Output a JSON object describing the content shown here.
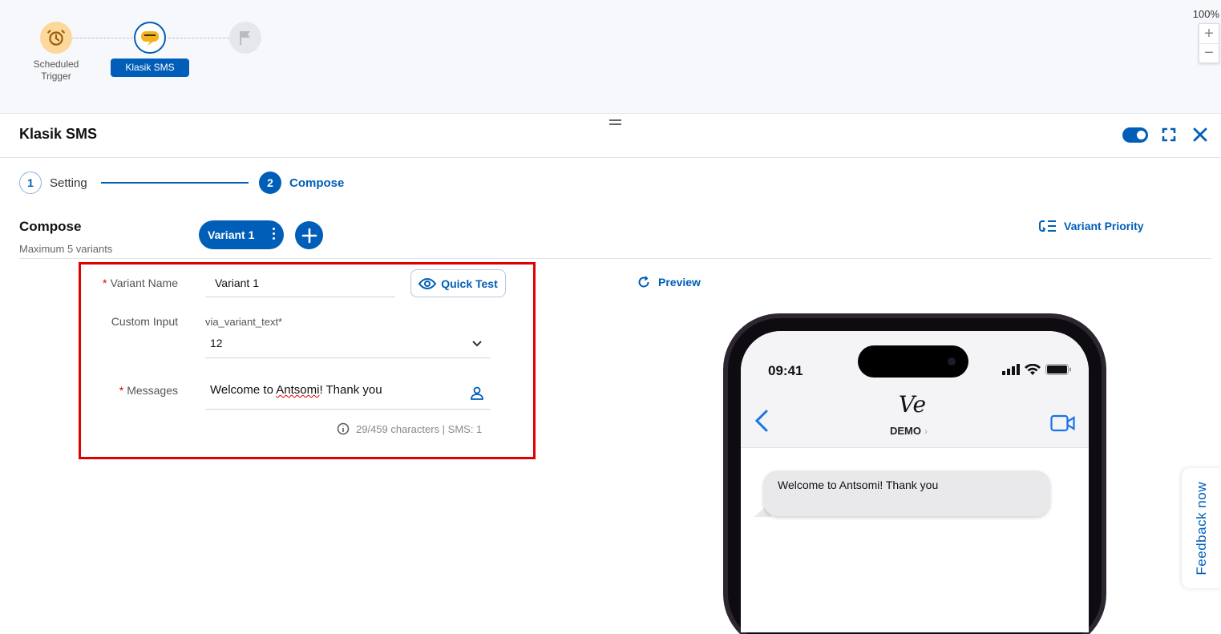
{
  "workflow": {
    "nodes": [
      {
        "label_line1": "Scheduled",
        "label_line2": "Trigger",
        "icon": "alarm-clock-icon"
      },
      {
        "label": "Klasik SMS",
        "icon": "klasik-sms-logo"
      },
      {
        "icon": "flag-icon"
      }
    ],
    "zoom_level": "100%",
    "zoom_in": "+",
    "zoom_out": "−"
  },
  "panel": {
    "title": "Klasik SMS"
  },
  "stepper": {
    "steps": [
      {
        "number": "1",
        "label": "Setting"
      },
      {
        "number": "2",
        "label": "Compose"
      }
    ]
  },
  "compose": {
    "title": "Compose",
    "subtitle": "Maximum 5 variants",
    "active_variant": "Variant 1",
    "variant_priority": "Variant Priority"
  },
  "form": {
    "variant_name_label": "Variant Name",
    "variant_name_value": "Variant 1",
    "quick_test": "Quick Test",
    "custom_input_label": "Custom Input",
    "custom_input_field": "via_variant_text*",
    "custom_input_value": "12",
    "messages_label": "Messages",
    "message_prefix": "Welcome to ",
    "message_misspelled": "Antsomi",
    "message_suffix": "! Thank you",
    "char_count": "29/459 characters | SMS: 1"
  },
  "preview": {
    "link": "Preview",
    "time": "09:41",
    "contact_avatar": "Ve",
    "contact_name": "DEMO",
    "message": "Welcome to Antsomi! Thank you"
  },
  "feedback": "Feedback now",
  "colors": {
    "primary": "#005eb8",
    "required": "#e00000",
    "highlight": "#e00000"
  }
}
